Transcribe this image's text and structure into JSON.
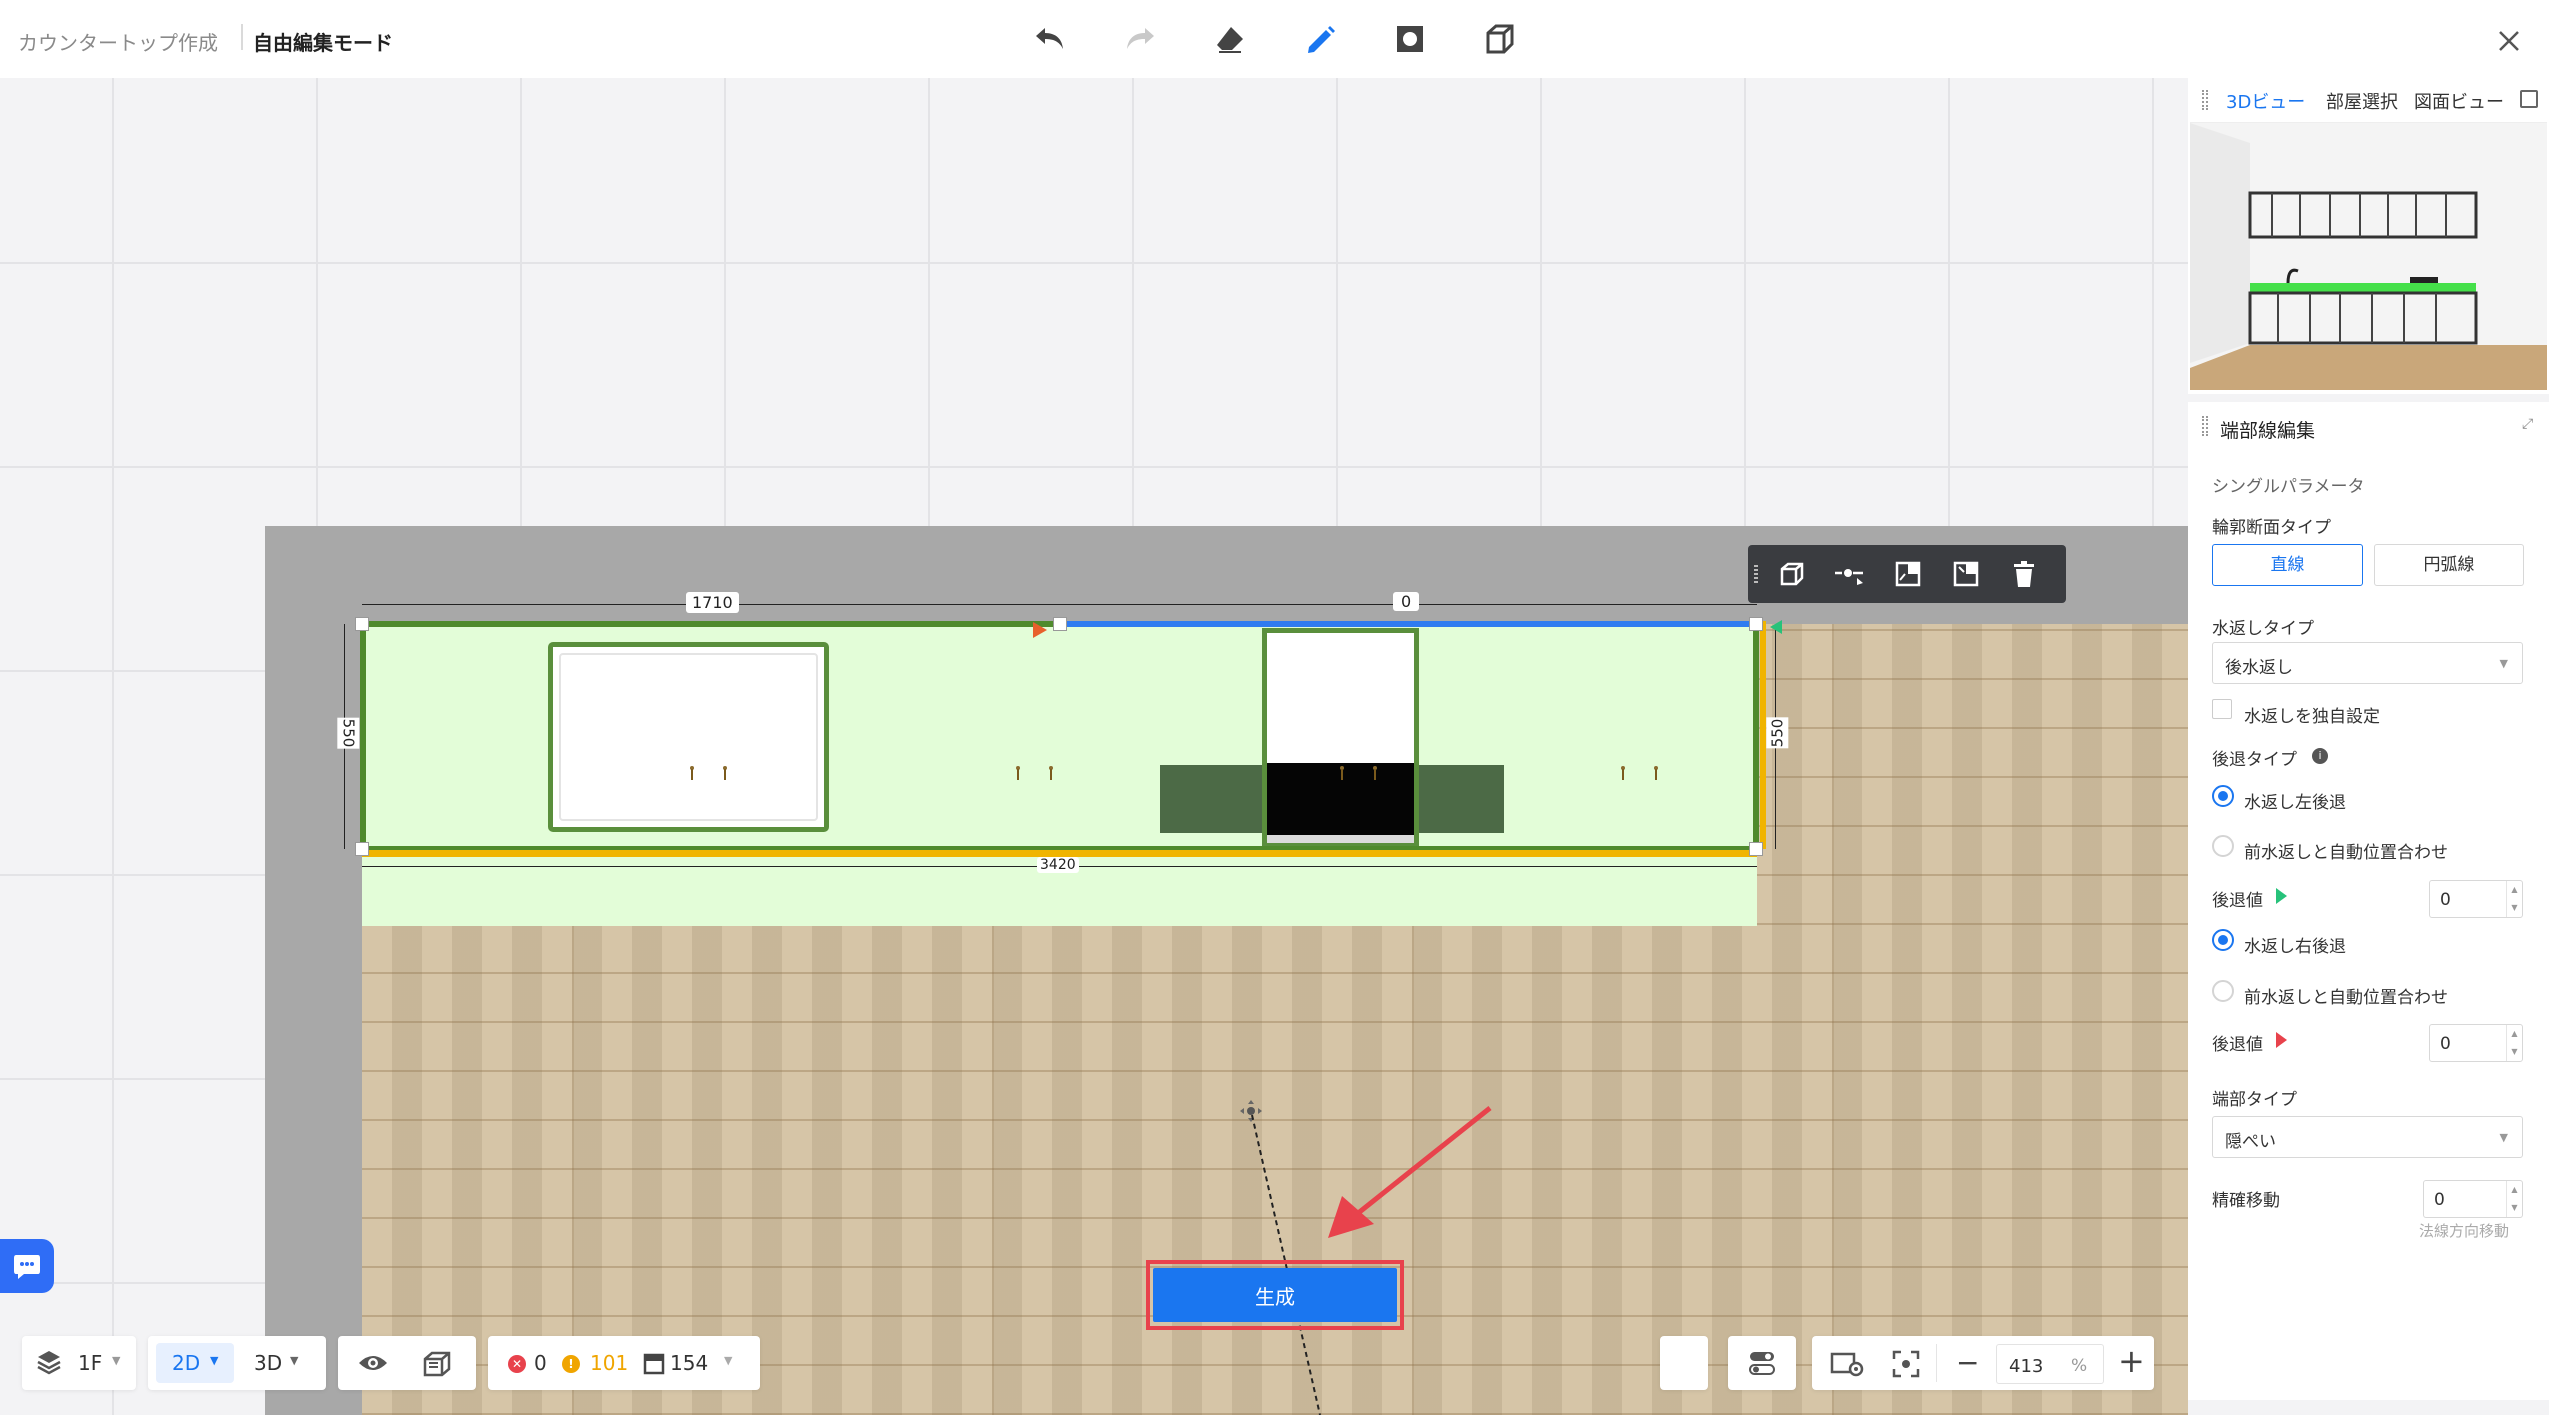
{
  "header": {
    "breadcrumb_parent": "カウンタートップ作成",
    "breadcrumb_current": "自由編集モード"
  },
  "toolbar": {
    "icons": [
      "undo-icon",
      "redo-icon",
      "eraser-icon",
      "pencil-icon",
      "square-icon",
      "box-icon",
      "close-icon"
    ],
    "sub_icons": [
      "cube-icon",
      "brush-icon",
      "edit-icon",
      "replace-icon"
    ]
  },
  "canvas": {
    "dim_top_left": "1710",
    "dim_top_right": "0",
    "dim_left": "550",
    "dim_right": "550",
    "dim_bottom": "3420",
    "generate_label": "生成"
  },
  "bottom": {
    "floor_label": "1F",
    "view_2d": "2D",
    "view_3d": "3D",
    "error_count": "0",
    "warning_count": "101",
    "item_count": "154",
    "zoom_value": "413",
    "zoom_unit": "%"
  },
  "preview": {
    "tabs": [
      "3Dビュー",
      "部屋選択",
      "図面ビュー"
    ]
  },
  "props": {
    "title": "端部線編集",
    "section": "シングルパラメータ",
    "profile_label": "輪郭断面タイプ",
    "profile_opt1": "直線",
    "profile_opt2": "円弧線",
    "backsplash_label": "水返しタイプ",
    "backsplash_value": "後水返し",
    "independent_label": "水返しを独自設定",
    "setback_label": "後退タイプ",
    "left_setback": "水返し左後退",
    "auto_align_1": "前水返しと自動位置合わせ",
    "setback_value_label_1": "後退値",
    "setback_value_1": "0",
    "right_setback": "水返し右後退",
    "auto_align_2": "前水返しと自動位置合わせ",
    "setback_value_label_2": "後退値",
    "setback_value_2": "0",
    "end_type_label": "端部タイプ",
    "end_type_value": "隠ぺい",
    "precise_label": "精確移動",
    "precise_value": "0",
    "precise_hint": "法線方向移動"
  },
  "colors": {
    "accent": "#1a76f0",
    "highlight_red": "#e8424c",
    "edge_green": "#4f8a2c",
    "edge_blue": "#2f7bf0",
    "edge_yellow": "#f0b400",
    "counter_fill": "#e3fdd8"
  }
}
